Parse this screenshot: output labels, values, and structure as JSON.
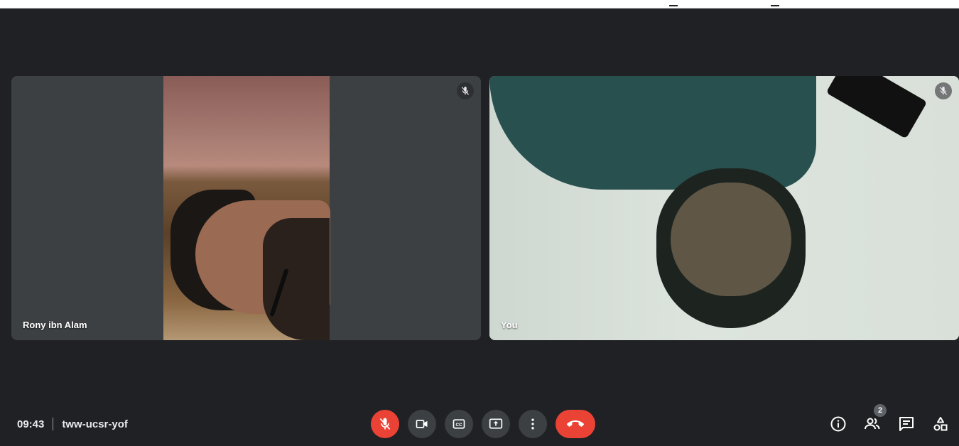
{
  "participants": [
    {
      "name": "Rony ibn Alam",
      "muted": true
    },
    {
      "name": "You",
      "muted": true
    }
  ],
  "meeting": {
    "time": "09:43",
    "code": "tww-ucsr-yof"
  },
  "controls": [
    {
      "id": "microphone",
      "icon": "mic-off-icon",
      "active_color": "#ea4335"
    },
    {
      "id": "camera",
      "icon": "video-camera-icon"
    },
    {
      "id": "captions",
      "icon": "closed-captions-icon"
    },
    {
      "id": "present",
      "icon": "present-screen-icon"
    },
    {
      "id": "more",
      "icon": "more-vert-icon"
    },
    {
      "id": "leave",
      "icon": "call-end-icon",
      "active_color": "#ea4335"
    }
  ],
  "side_panel": {
    "info_icon": "info-icon",
    "people_icon": "people-icon",
    "people_count": "2",
    "chat_icon": "chat-icon",
    "activities_icon": "activities-icon"
  },
  "colors": {
    "background": "#202124",
    "tile": "#3c4043",
    "danger": "#ea4335"
  }
}
